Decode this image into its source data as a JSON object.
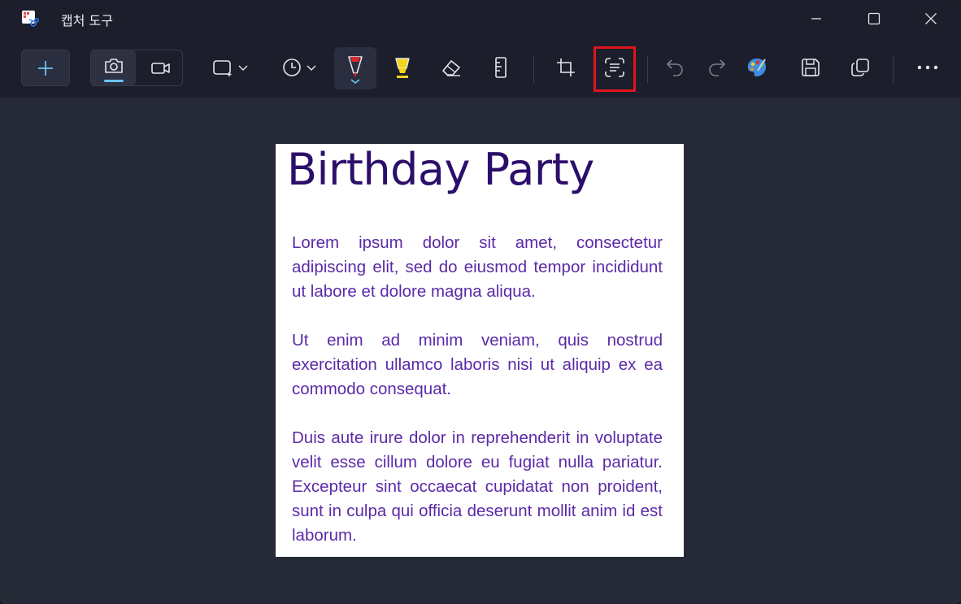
{
  "window": {
    "title": "캡처 도구",
    "icons": [
      "snipping-tool-app-icon",
      "minimize-icon",
      "maximize-icon",
      "close-icon"
    ]
  },
  "toolbar": {
    "items": [
      {
        "name": "new-snip",
        "icon": "plus-icon"
      },
      {
        "name": "photo-mode",
        "icon": "camera-icon",
        "selected": true
      },
      {
        "name": "video-mode",
        "icon": "video-camera-icon"
      },
      {
        "name": "snip-shape",
        "icon": "rectangle-snip-icon",
        "dropdown": true
      },
      {
        "name": "delay",
        "icon": "clock-icon",
        "dropdown": true
      },
      {
        "name": "ballpoint-pen",
        "icon": "pen-icon",
        "selected": true
      },
      {
        "name": "highlighter",
        "icon": "highlighter-icon"
      },
      {
        "name": "eraser",
        "icon": "eraser-icon"
      },
      {
        "name": "ruler",
        "icon": "ruler-icon"
      },
      {
        "name": "crop",
        "icon": "crop-icon"
      },
      {
        "name": "text-actions",
        "icon": "text-actions-icon",
        "highlighted": true
      },
      {
        "name": "undo",
        "icon": "undo-icon"
      },
      {
        "name": "redo",
        "icon": "redo-icon"
      },
      {
        "name": "edit-in-paint",
        "icon": "paint-palette-icon"
      },
      {
        "name": "save",
        "icon": "save-icon"
      },
      {
        "name": "copy",
        "icon": "copy-icon"
      },
      {
        "name": "more",
        "icon": "more-icon"
      }
    ],
    "accent_color": "#6cc4f5",
    "highlight_color": "#e0151b"
  },
  "document": {
    "title": "Birthday Party",
    "paragraphs": [
      "Lorem ipsum dolor sit amet, consectetur adipiscing elit, sed do eiusmod tempor incididunt ut labore et dolore magna aliqua.",
      "Ut enim ad minim veniam, quis nostrud exercitation ullamco laboris nisi ut aliquip ex ea commodo consequat.",
      "Duis aute irure dolor in reprehenderit in voluptate velit esse cillum dolore eu fugiat nulla pariatur. Excepteur sint occaecat cupidatat non proident, sunt in culpa qui officia deserunt mollit anim id est laborum."
    ],
    "title_color": "#2b0f6b",
    "text_color": "#5b2aa8"
  }
}
